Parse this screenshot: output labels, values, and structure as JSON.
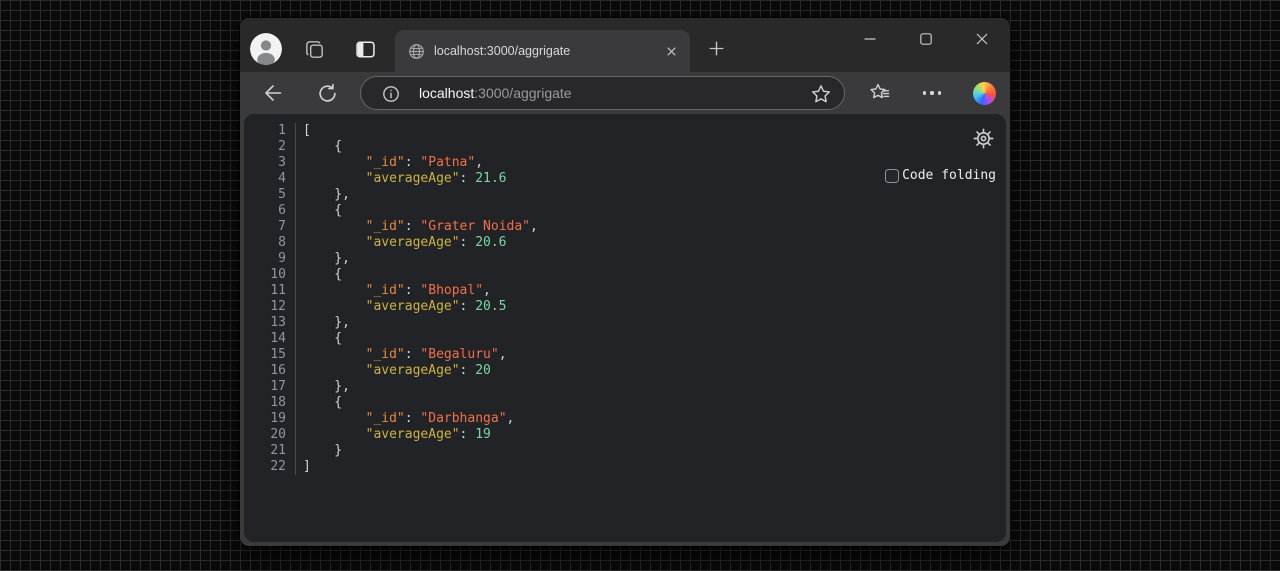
{
  "browser": {
    "tab": {
      "title": "localhost:3000/aggrigate"
    },
    "address": {
      "host": "localhost",
      "path": ":3000/aggrigate"
    },
    "icons": [
      "profile-avatar-icon",
      "workspaces-icon",
      "tab-actions-icon",
      "globe-favicon-icon",
      "tab-close-icon",
      "new-tab-icon",
      "minimize-icon",
      "maximize-icon",
      "close-icon",
      "back-icon",
      "refresh-icon",
      "site-info-icon",
      "favorite-star-icon",
      "favorites-list-icon",
      "more-ellipsis-icon",
      "copilot-icon"
    ]
  },
  "viewer": {
    "settings_icon": "gear-icon",
    "code_folding": {
      "label": "Code folding",
      "checked": false
    },
    "line_count": 22,
    "json_records": [
      {
        "_id": "Patna",
        "averageAge": 21.6
      },
      {
        "_id": "Grater Noida",
        "averageAge": 20.6
      },
      {
        "_id": "Bhopal",
        "averageAge": 20.5
      },
      {
        "_id": "Begaluru",
        "averageAge": 20
      },
      {
        "_id": "Darbhanga",
        "averageAge": 19
      }
    ],
    "syntax_colors": {
      "key": "#e08a43",
      "key2": "#cdb246",
      "string": "#f1704a",
      "number": "#7bd8a0",
      "punct": "#d2d5d9",
      "line_number": "#8f979f"
    }
  }
}
